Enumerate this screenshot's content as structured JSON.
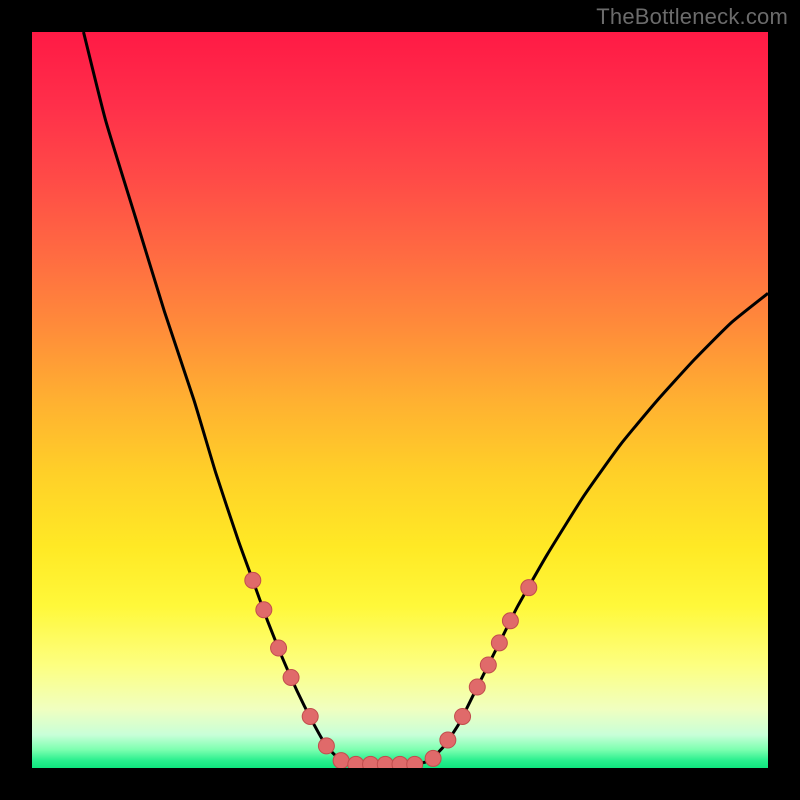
{
  "watermark": "TheBottleneck.com",
  "colors": {
    "frame_bg": "#000000",
    "curve_stroke": "#000000",
    "marker_fill": "#e06a6a",
    "marker_stroke": "#c24d4d",
    "marker_radius": 8,
    "gradient_stops": [
      {
        "offset": 0.0,
        "color": "#ff1a45"
      },
      {
        "offset": 0.1,
        "color": "#ff2f4a"
      },
      {
        "offset": 0.2,
        "color": "#ff4b47"
      },
      {
        "offset": 0.3,
        "color": "#ff6a42"
      },
      {
        "offset": 0.4,
        "color": "#ff8b3a"
      },
      {
        "offset": 0.5,
        "color": "#ffb031"
      },
      {
        "offset": 0.6,
        "color": "#ffd028"
      },
      {
        "offset": 0.7,
        "color": "#ffe925"
      },
      {
        "offset": 0.78,
        "color": "#fff83a"
      },
      {
        "offset": 0.86,
        "color": "#fdff80"
      },
      {
        "offset": 0.92,
        "color": "#f0ffc0"
      },
      {
        "offset": 0.955,
        "color": "#c8ffd8"
      },
      {
        "offset": 0.975,
        "color": "#7dffb0"
      },
      {
        "offset": 0.99,
        "color": "#28ef8d"
      },
      {
        "offset": 1.0,
        "color": "#0fe57e"
      }
    ]
  },
  "chart_data": {
    "type": "line",
    "title": "",
    "xlabel": "",
    "ylabel": "",
    "xlim": [
      0,
      100
    ],
    "ylim": [
      0,
      100
    ],
    "grid": false,
    "series": [
      {
        "name": "curve",
        "points": [
          {
            "x": 7.0,
            "y": 100.0
          },
          {
            "x": 10.0,
            "y": 88.0
          },
          {
            "x": 14.0,
            "y": 75.0
          },
          {
            "x": 18.0,
            "y": 62.0
          },
          {
            "x": 22.0,
            "y": 50.0
          },
          {
            "x": 25.0,
            "y": 40.0
          },
          {
            "x": 28.0,
            "y": 31.0
          },
          {
            "x": 30.0,
            "y": 25.5
          },
          {
            "x": 32.0,
            "y": 20.0
          },
          {
            "x": 34.0,
            "y": 15.0
          },
          {
            "x": 36.0,
            "y": 10.5
          },
          {
            "x": 38.0,
            "y": 6.5
          },
          {
            "x": 40.0,
            "y": 3.0
          },
          {
            "x": 42.0,
            "y": 1.0
          },
          {
            "x": 44.0,
            "y": 0.5
          },
          {
            "x": 46.0,
            "y": 0.5
          },
          {
            "x": 48.0,
            "y": 0.5
          },
          {
            "x": 50.0,
            "y": 0.5
          },
          {
            "x": 52.0,
            "y": 0.5
          },
          {
            "x": 54.0,
            "y": 1.0
          },
          {
            "x": 56.0,
            "y": 3.0
          },
          {
            "x": 58.0,
            "y": 6.0
          },
          {
            "x": 60.0,
            "y": 10.0
          },
          {
            "x": 62.0,
            "y": 14.0
          },
          {
            "x": 64.0,
            "y": 18.0
          },
          {
            "x": 66.0,
            "y": 22.0
          },
          {
            "x": 70.0,
            "y": 29.0
          },
          {
            "x": 75.0,
            "y": 37.0
          },
          {
            "x": 80.0,
            "y": 44.0
          },
          {
            "x": 85.0,
            "y": 50.0
          },
          {
            "x": 90.0,
            "y": 55.5
          },
          {
            "x": 95.0,
            "y": 60.5
          },
          {
            "x": 100.0,
            "y": 64.5
          }
        ]
      }
    ],
    "markers": [
      {
        "x": 30.0,
        "y": 25.5
      },
      {
        "x": 31.5,
        "y": 21.5
      },
      {
        "x": 33.5,
        "y": 16.3
      },
      {
        "x": 35.2,
        "y": 12.3
      },
      {
        "x": 37.8,
        "y": 7.0
      },
      {
        "x": 40.0,
        "y": 3.0
      },
      {
        "x": 42.0,
        "y": 1.0
      },
      {
        "x": 44.0,
        "y": 0.5
      },
      {
        "x": 46.0,
        "y": 0.5
      },
      {
        "x": 48.0,
        "y": 0.5
      },
      {
        "x": 50.0,
        "y": 0.5
      },
      {
        "x": 52.0,
        "y": 0.5
      },
      {
        "x": 54.5,
        "y": 1.3
      },
      {
        "x": 56.5,
        "y": 3.8
      },
      {
        "x": 58.5,
        "y": 7.0
      },
      {
        "x": 60.5,
        "y": 11.0
      },
      {
        "x": 62.0,
        "y": 14.0
      },
      {
        "x": 63.5,
        "y": 17.0
      },
      {
        "x": 65.0,
        "y": 20.0
      },
      {
        "x": 67.5,
        "y": 24.5
      }
    ]
  }
}
